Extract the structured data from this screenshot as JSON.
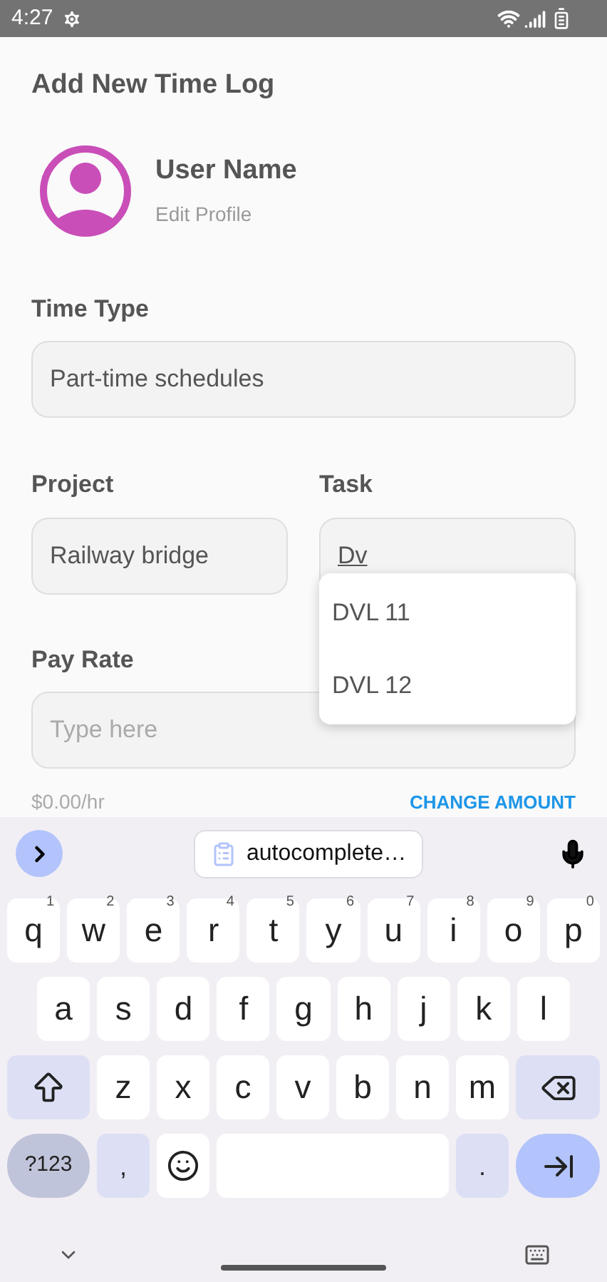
{
  "status_bar": {
    "time": "4:27"
  },
  "title": "Add New Time Log",
  "profile": {
    "name": "User Name",
    "link": "Edit Profile"
  },
  "time_type": {
    "label": "Time Type",
    "value": "Part-time schedules"
  },
  "project": {
    "label": "Project",
    "value": "Railway bridge"
  },
  "task": {
    "label": "Task",
    "value": "Dv"
  },
  "suggestions": [
    "DVL 11",
    "DVL 12"
  ],
  "pay_rate": {
    "label": "Pay Rate",
    "placeholder": "Type here",
    "rate": "$0.00/hr",
    "action": "CHANGE AMOUNT"
  },
  "keyboard": {
    "suggestion": "autocomplete…",
    "rows": [
      {
        "keys": [
          {
            "kind": "letter",
            "label": "q",
            "hint": "1"
          },
          {
            "kind": "letter",
            "label": "w",
            "hint": "2"
          },
          {
            "kind": "letter",
            "label": "e",
            "hint": "3"
          },
          {
            "kind": "letter",
            "label": "r",
            "hint": "4"
          },
          {
            "kind": "letter",
            "label": "t",
            "hint": "5"
          },
          {
            "kind": "letter",
            "label": "y",
            "hint": "6"
          },
          {
            "kind": "letter",
            "label": "u",
            "hint": "7"
          },
          {
            "kind": "letter",
            "label": "i",
            "hint": "8"
          },
          {
            "kind": "letter",
            "label": "o",
            "hint": "9"
          },
          {
            "kind": "letter",
            "label": "p",
            "hint": "0"
          }
        ]
      },
      {
        "keys": [
          {
            "kind": "letter",
            "label": "a"
          },
          {
            "kind": "letter",
            "label": "s"
          },
          {
            "kind": "letter",
            "label": "d"
          },
          {
            "kind": "letter",
            "label": "f"
          },
          {
            "kind": "letter",
            "label": "g"
          },
          {
            "kind": "letter",
            "label": "h"
          },
          {
            "kind": "letter",
            "label": "j"
          },
          {
            "kind": "letter",
            "label": "k"
          },
          {
            "kind": "letter",
            "label": "l"
          }
        ]
      },
      {
        "keys": [
          {
            "kind": "shift"
          },
          {
            "kind": "letter",
            "label": "z"
          },
          {
            "kind": "letter",
            "label": "x"
          },
          {
            "kind": "letter",
            "label": "c"
          },
          {
            "kind": "letter",
            "label": "v"
          },
          {
            "kind": "letter",
            "label": "b"
          },
          {
            "kind": "letter",
            "label": "n"
          },
          {
            "kind": "letter",
            "label": "m"
          },
          {
            "kind": "backspace"
          }
        ]
      },
      {
        "keys": [
          {
            "kind": "symbols",
            "label": "?123"
          },
          {
            "kind": "punct",
            "label": ","
          },
          {
            "kind": "emoji"
          },
          {
            "kind": "space"
          },
          {
            "kind": "punct",
            "label": "."
          },
          {
            "kind": "enter"
          }
        ]
      }
    ]
  }
}
